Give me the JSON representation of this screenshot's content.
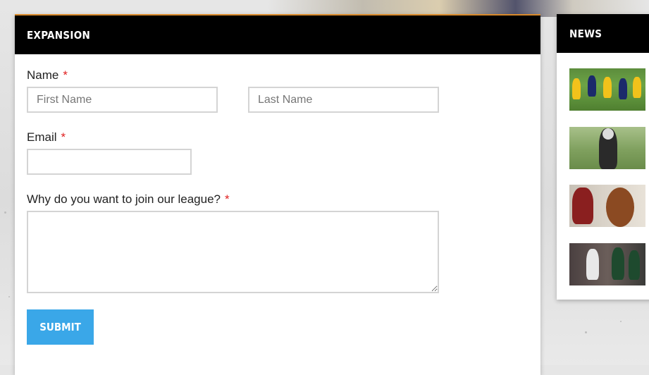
{
  "form_panel": {
    "title": "EXPANSION",
    "name": {
      "label": "Name",
      "required_mark": "*",
      "first_placeholder": "First Name",
      "last_placeholder": "Last Name",
      "first_value": "",
      "last_value": ""
    },
    "email": {
      "label": "Email",
      "required_mark": "*",
      "value": ""
    },
    "reason": {
      "label": "Why do you want to join our league?",
      "required_mark": "*",
      "value": ""
    },
    "submit_label": "SUBMIT"
  },
  "news_panel": {
    "title": "NEWS",
    "thumbnails": [
      {
        "icon": "football-team-practice-thumbnail"
      },
      {
        "icon": "youth-player-thumbnail"
      },
      {
        "icon": "football-ball-thumbnail"
      },
      {
        "icon": "game-action-thumbnail"
      }
    ]
  },
  "colors": {
    "header_bg": "#000000",
    "accent": "#3aa7e8",
    "required": "#e02020"
  }
}
